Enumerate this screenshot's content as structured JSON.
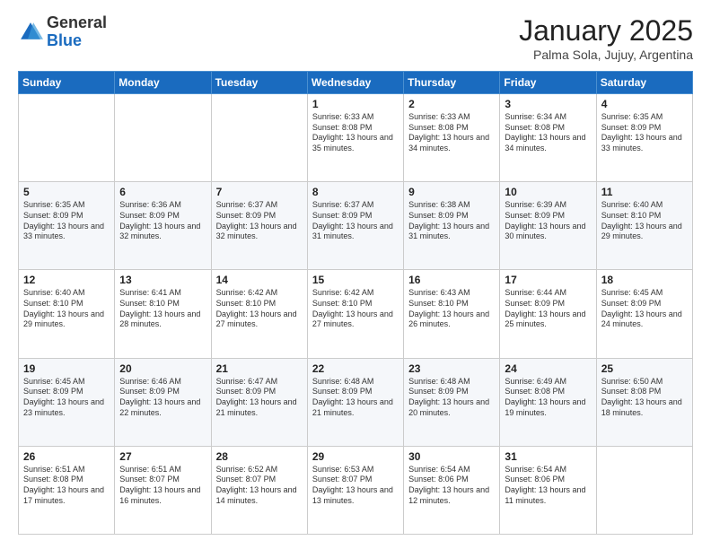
{
  "header": {
    "logo_general": "General",
    "logo_blue": "Blue",
    "month_title": "January 2025",
    "location": "Palma Sola, Jujuy, Argentina"
  },
  "days_of_week": [
    "Sunday",
    "Monday",
    "Tuesday",
    "Wednesday",
    "Thursday",
    "Friday",
    "Saturday"
  ],
  "weeks": [
    [
      {
        "num": "",
        "info": ""
      },
      {
        "num": "",
        "info": ""
      },
      {
        "num": "",
        "info": ""
      },
      {
        "num": "1",
        "info": "Sunrise: 6:33 AM\nSunset: 8:08 PM\nDaylight: 13 hours and 35 minutes."
      },
      {
        "num": "2",
        "info": "Sunrise: 6:33 AM\nSunset: 8:08 PM\nDaylight: 13 hours and 34 minutes."
      },
      {
        "num": "3",
        "info": "Sunrise: 6:34 AM\nSunset: 8:08 PM\nDaylight: 13 hours and 34 minutes."
      },
      {
        "num": "4",
        "info": "Sunrise: 6:35 AM\nSunset: 8:09 PM\nDaylight: 13 hours and 33 minutes."
      }
    ],
    [
      {
        "num": "5",
        "info": "Sunrise: 6:35 AM\nSunset: 8:09 PM\nDaylight: 13 hours and 33 minutes."
      },
      {
        "num": "6",
        "info": "Sunrise: 6:36 AM\nSunset: 8:09 PM\nDaylight: 13 hours and 32 minutes."
      },
      {
        "num": "7",
        "info": "Sunrise: 6:37 AM\nSunset: 8:09 PM\nDaylight: 13 hours and 32 minutes."
      },
      {
        "num": "8",
        "info": "Sunrise: 6:37 AM\nSunset: 8:09 PM\nDaylight: 13 hours and 31 minutes."
      },
      {
        "num": "9",
        "info": "Sunrise: 6:38 AM\nSunset: 8:09 PM\nDaylight: 13 hours and 31 minutes."
      },
      {
        "num": "10",
        "info": "Sunrise: 6:39 AM\nSunset: 8:09 PM\nDaylight: 13 hours and 30 minutes."
      },
      {
        "num": "11",
        "info": "Sunrise: 6:40 AM\nSunset: 8:10 PM\nDaylight: 13 hours and 29 minutes."
      }
    ],
    [
      {
        "num": "12",
        "info": "Sunrise: 6:40 AM\nSunset: 8:10 PM\nDaylight: 13 hours and 29 minutes."
      },
      {
        "num": "13",
        "info": "Sunrise: 6:41 AM\nSunset: 8:10 PM\nDaylight: 13 hours and 28 minutes."
      },
      {
        "num": "14",
        "info": "Sunrise: 6:42 AM\nSunset: 8:10 PM\nDaylight: 13 hours and 27 minutes."
      },
      {
        "num": "15",
        "info": "Sunrise: 6:42 AM\nSunset: 8:10 PM\nDaylight: 13 hours and 27 minutes."
      },
      {
        "num": "16",
        "info": "Sunrise: 6:43 AM\nSunset: 8:10 PM\nDaylight: 13 hours and 26 minutes."
      },
      {
        "num": "17",
        "info": "Sunrise: 6:44 AM\nSunset: 8:09 PM\nDaylight: 13 hours and 25 minutes."
      },
      {
        "num": "18",
        "info": "Sunrise: 6:45 AM\nSunset: 8:09 PM\nDaylight: 13 hours and 24 minutes."
      }
    ],
    [
      {
        "num": "19",
        "info": "Sunrise: 6:45 AM\nSunset: 8:09 PM\nDaylight: 13 hours and 23 minutes."
      },
      {
        "num": "20",
        "info": "Sunrise: 6:46 AM\nSunset: 8:09 PM\nDaylight: 13 hours and 22 minutes."
      },
      {
        "num": "21",
        "info": "Sunrise: 6:47 AM\nSunset: 8:09 PM\nDaylight: 13 hours and 21 minutes."
      },
      {
        "num": "22",
        "info": "Sunrise: 6:48 AM\nSunset: 8:09 PM\nDaylight: 13 hours and 21 minutes."
      },
      {
        "num": "23",
        "info": "Sunrise: 6:48 AM\nSunset: 8:09 PM\nDaylight: 13 hours and 20 minutes."
      },
      {
        "num": "24",
        "info": "Sunrise: 6:49 AM\nSunset: 8:08 PM\nDaylight: 13 hours and 19 minutes."
      },
      {
        "num": "25",
        "info": "Sunrise: 6:50 AM\nSunset: 8:08 PM\nDaylight: 13 hours and 18 minutes."
      }
    ],
    [
      {
        "num": "26",
        "info": "Sunrise: 6:51 AM\nSunset: 8:08 PM\nDaylight: 13 hours and 17 minutes."
      },
      {
        "num": "27",
        "info": "Sunrise: 6:51 AM\nSunset: 8:07 PM\nDaylight: 13 hours and 16 minutes."
      },
      {
        "num": "28",
        "info": "Sunrise: 6:52 AM\nSunset: 8:07 PM\nDaylight: 13 hours and 14 minutes."
      },
      {
        "num": "29",
        "info": "Sunrise: 6:53 AM\nSunset: 8:07 PM\nDaylight: 13 hours and 13 minutes."
      },
      {
        "num": "30",
        "info": "Sunrise: 6:54 AM\nSunset: 8:06 PM\nDaylight: 13 hours and 12 minutes."
      },
      {
        "num": "31",
        "info": "Sunrise: 6:54 AM\nSunset: 8:06 PM\nDaylight: 13 hours and 11 minutes."
      },
      {
        "num": "",
        "info": ""
      }
    ]
  ]
}
